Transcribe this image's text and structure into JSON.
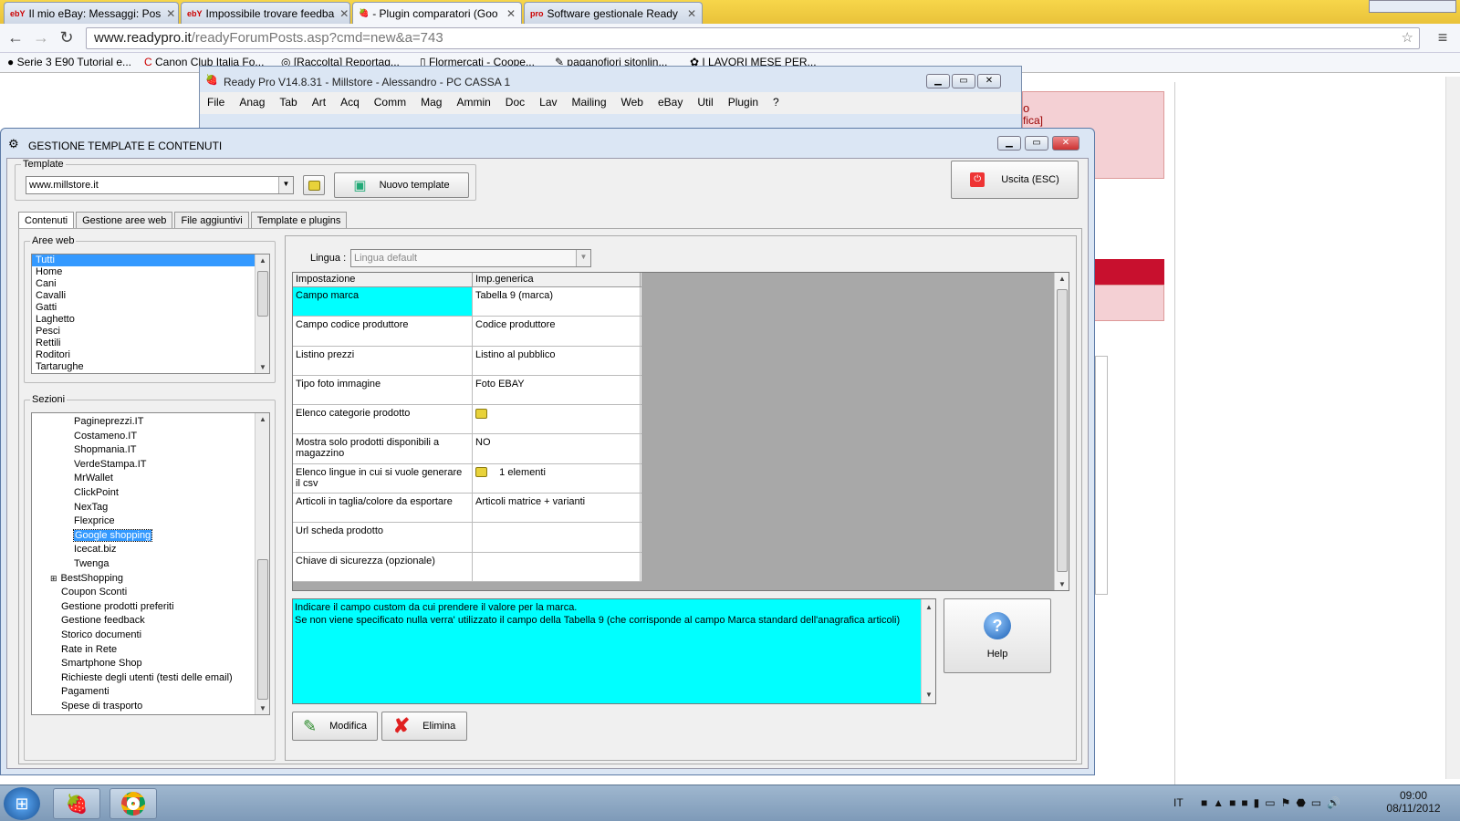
{
  "browser": {
    "tabs": [
      {
        "favicon": "ebY",
        "label": "Il mio eBay: Messaggi: Pos"
      },
      {
        "favicon": "ebY",
        "label": "Impossibile trovare feedba"
      },
      {
        "favicon": "strawberry",
        "label": "- Plugin comparatori (Goo"
      },
      {
        "favicon": "pro",
        "label": "Software gestionale Ready"
      }
    ],
    "url_host": "www.readypro.it",
    "url_path": "/readyForumPosts.asp?cmd=new&a=743",
    "bookmarks": [
      "Serie 3 E90 Tutorial e...",
      "Canon Club Italia Fo...",
      "[Raccolta] Reportag...",
      "Flormercati - Coope...",
      "paganofiori sitonlin...",
      "I LAVORI MESE PER..."
    ],
    "page_fragments": [
      "o",
      "fica]"
    ]
  },
  "readypro": {
    "title": "Ready Pro V14.8.31 - Millstore - Alessandro - PC CASSA 1",
    "menu": [
      "File",
      "Anag",
      "Tab",
      "Art",
      "Acq",
      "Comm",
      "Mag",
      "Ammin",
      "Doc",
      "Lav",
      "Mailing",
      "Web",
      "eBay",
      "Util",
      "Plugin",
      "?"
    ]
  },
  "dialog": {
    "title": "GESTIONE TEMPLATE E CONTENUTI",
    "template_legend": "Template",
    "template_value": "www.millstore.it",
    "new_template_label": "Nuovo template",
    "exit_label": "Uscita (ESC)",
    "tabs": [
      "Contenuti",
      "Gestione aree web",
      "File aggiuntivi",
      "Template e plugins"
    ],
    "aree_legend": "Aree web",
    "aree": [
      "Tutti",
      "Home",
      "Cani",
      "Cavalli",
      "Gatti",
      "Laghetto",
      "Pesci",
      "Rettili",
      "Roditori",
      "Tartarughe"
    ],
    "sezioni_legend": "Sezioni",
    "sezioni_children": [
      "Pagineprezzi.IT",
      "Costameno.IT",
      "Shopmania.IT",
      "VerdeStampa.IT",
      "MrWallet",
      "ClickPoint",
      "NexTag",
      "Flexprice",
      "Google shopping",
      "Icecat.biz",
      "Twenga"
    ],
    "sezioni_top": [
      "BestShopping",
      "Coupon Sconti",
      "Gestione prodotti preferiti",
      "Gestione feedback",
      "Storico documenti",
      "Rate in Rete",
      "Smartphone Shop",
      "Richieste degli utenti (testi delle email)",
      "Pagamenti",
      "Spese di trasporto"
    ],
    "lingua_label": "Lingua :",
    "lingua_value": "Lingua default",
    "grid_headers": [
      "Impostazione",
      "Imp.generica"
    ],
    "grid_rows": [
      {
        "name": "Campo marca",
        "value": "Tabella 9 (marca)"
      },
      {
        "name": "Campo codice produttore",
        "value": "Codice produttore"
      },
      {
        "name": "Listino prezzi",
        "value": "Listino al pubblico"
      },
      {
        "name": "Tipo foto immagine",
        "value": "Foto EBAY"
      },
      {
        "name": "Elenco categorie prodotto",
        "value": ""
      },
      {
        "name": "Mostra solo prodotti disponibili a magazzino",
        "value": "NO"
      },
      {
        "name": "Elenco lingue in cui si vuole generare il csv",
        "value": "1 elementi"
      },
      {
        "name": "Articoli in taglia/colore da esportare",
        "value": "Articoli matrice + varianti"
      },
      {
        "name": "Url scheda prodotto",
        "value": ""
      },
      {
        "name": "Chiave di sicurezza (opzionale)",
        "value": ""
      }
    ],
    "description_line1": "Indicare il campo custom da cui prendere il valore per la marca.",
    "description_line2": "Se non viene specificato nulla verra' utilizzato il campo della Tabella 9 (che corrisponde al campo Marca standard dell'anagrafica articoli)",
    "help_label": "Help",
    "modifica_label": "Modifica",
    "elimina_label": "Elimina"
  },
  "taskbar": {
    "language": "IT",
    "time": "09:00",
    "date": "08/11/2012"
  }
}
